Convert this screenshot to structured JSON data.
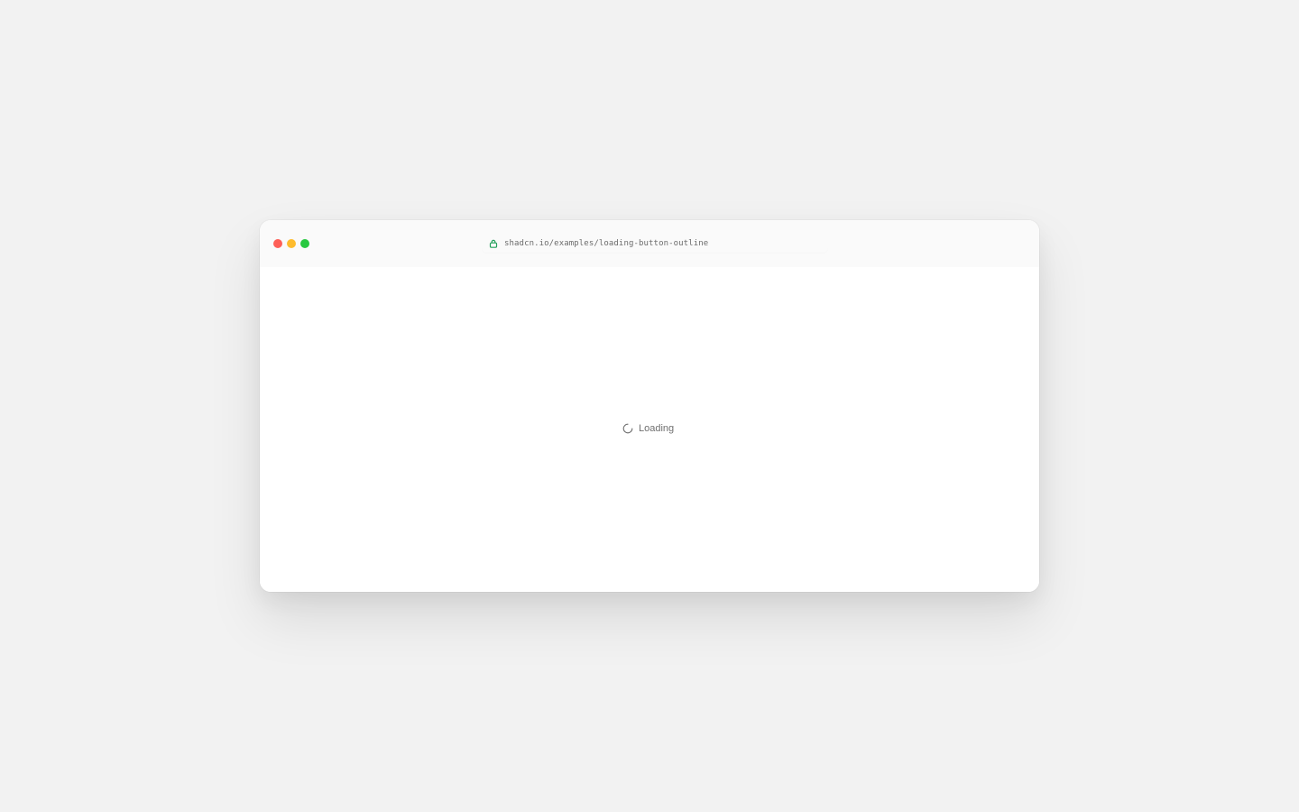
{
  "window": {
    "controls": [
      {
        "name": "close",
        "color": "#fe5f57"
      },
      {
        "name": "minimize",
        "color": "#febc2e"
      },
      {
        "name": "maximize",
        "color": "#28c840"
      }
    ]
  },
  "address_bar": {
    "url": "shadcn.io/examples/loading-button-outline",
    "icon": "lock-icon",
    "lock_color": "#22a05a"
  },
  "content": {
    "loading_text": "Loading",
    "icon": "spinner-icon"
  }
}
